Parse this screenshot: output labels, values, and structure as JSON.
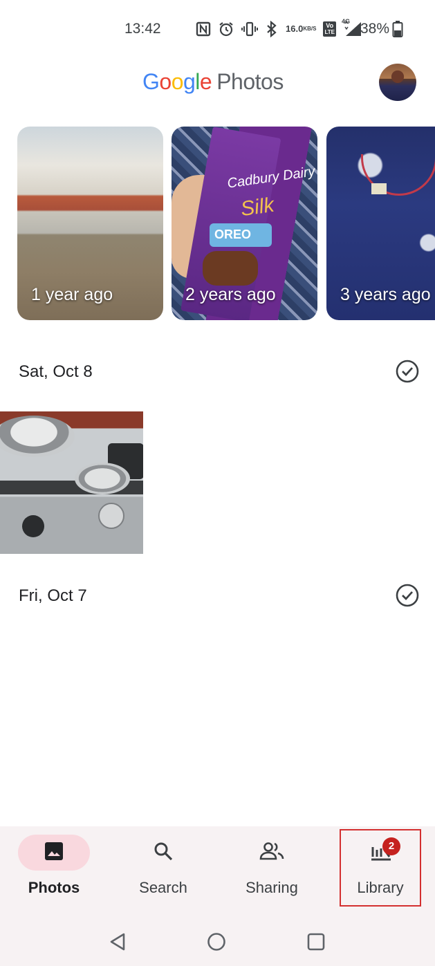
{
  "status_bar": {
    "time": "13:42",
    "net_speed_value": "16.0",
    "net_speed_unit": "KB/S",
    "volte_top": "Vo",
    "volte_bottom": "LTE",
    "network": "4G",
    "battery_percent": "38%",
    "icons": [
      "nfc-icon",
      "alarm-icon",
      "vibrate-icon",
      "bluetooth-icon",
      "volte-icon",
      "signal-icon",
      "battery-icon"
    ]
  },
  "header": {
    "logo_letters": [
      "G",
      "o",
      "o",
      "g",
      "l",
      "e"
    ],
    "logo_suffix": "Photos",
    "colors": {
      "blue": "#4285F4",
      "red": "#EA4335",
      "yellow": "#FBBC05",
      "green": "#34A853"
    }
  },
  "memories": [
    {
      "label": "1 year ago"
    },
    {
      "label": "2 years ago",
      "photo_text": [
        "Cadbury Dairy Milk",
        "Silk",
        "OREO"
      ]
    },
    {
      "label": "3 years ago"
    }
  ],
  "sections": [
    {
      "date": "Sat, Oct 8"
    },
    {
      "date": "Fri, Oct 7"
    }
  ],
  "bottom_nav": {
    "items": [
      {
        "label": "Photos",
        "icon": "image-icon",
        "active": true
      },
      {
        "label": "Search",
        "icon": "search-icon",
        "active": false
      },
      {
        "label": "Sharing",
        "icon": "people-icon",
        "active": false
      },
      {
        "label": "Library",
        "icon": "library-icon",
        "active": false,
        "badge": "2"
      }
    ],
    "active_color": "#f9d8de",
    "badge_color": "#c5221f"
  },
  "system_nav": {
    "buttons": [
      "back-button",
      "home-button",
      "recents-button"
    ]
  }
}
